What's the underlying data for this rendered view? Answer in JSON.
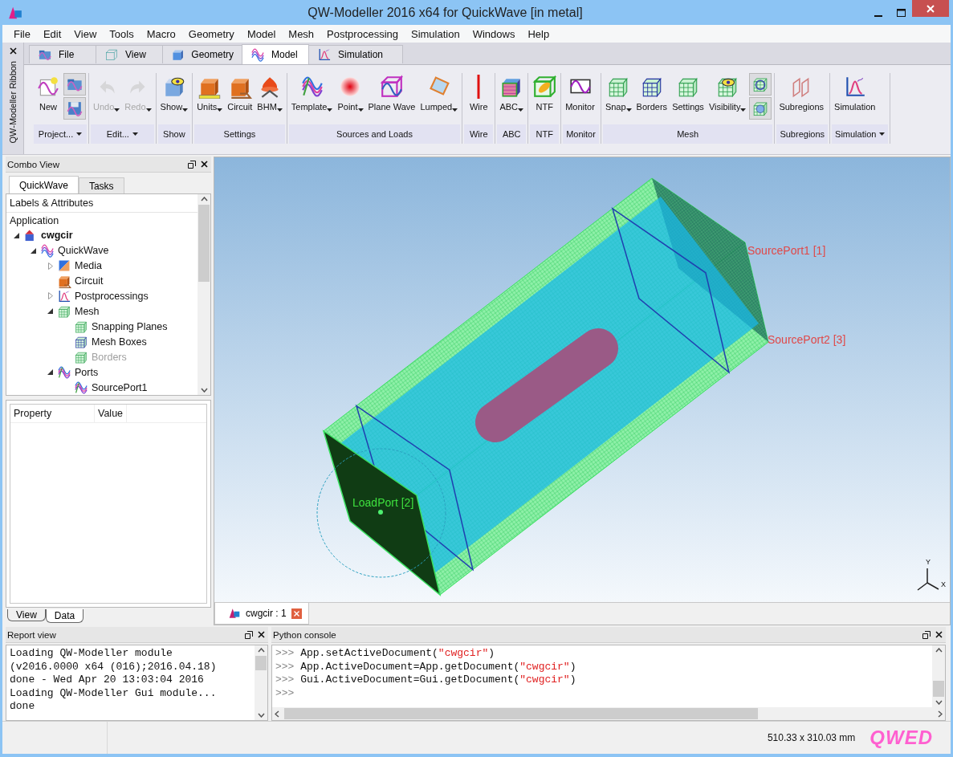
{
  "window": {
    "title": "QW-Modeller 2016 x64 for QuickWave [in metal]"
  },
  "menu": [
    "File",
    "Edit",
    "View",
    "Tools",
    "Macro",
    "Geometry",
    "Model",
    "Mesh",
    "Postprocessing",
    "Simulation",
    "Windows",
    "Help"
  ],
  "ribbon": {
    "side_label": "QW-Modeller Ribbon",
    "tabs": [
      {
        "label": "File",
        "selected": false
      },
      {
        "label": "View",
        "selected": false
      },
      {
        "label": "Geometry",
        "selected": false
      },
      {
        "label": "Model",
        "selected": true
      },
      {
        "label": "Simulation",
        "selected": false
      }
    ],
    "groups": [
      {
        "label": "Project...",
        "menu": true,
        "buttons": [
          {
            "kind": "large",
            "label": "New",
            "dropdown": false,
            "disabled": false
          },
          {
            "kind": "small"
          },
          {
            "kind": "small"
          }
        ]
      },
      {
        "label": "Edit...",
        "menu": true,
        "buttons": [
          {
            "kind": "large",
            "label": "Undo",
            "dropdown": true,
            "disabled": true
          },
          {
            "kind": "large",
            "label": "Redo",
            "dropdown": true,
            "disabled": true
          }
        ]
      },
      {
        "label": "Show",
        "menu": false,
        "buttons": [
          {
            "kind": "large",
            "label": "Show",
            "dropdown": true,
            "disabled": false
          }
        ]
      },
      {
        "label": "Settings",
        "menu": false,
        "buttons": [
          {
            "kind": "large",
            "label": "Units",
            "dropdown": true,
            "disabled": false
          },
          {
            "kind": "large",
            "label": "Circuit",
            "dropdown": false,
            "disabled": false
          },
          {
            "kind": "large",
            "label": "BHM",
            "dropdown": true,
            "disabled": false
          }
        ]
      },
      {
        "label": "Sources and Loads",
        "menu": false,
        "buttons": [
          {
            "kind": "large",
            "label": "Template",
            "dropdown": true,
            "disabled": false
          },
          {
            "kind": "large",
            "label": "Point",
            "dropdown": true,
            "disabled": false
          },
          {
            "kind": "large",
            "label": "Plane Wave",
            "dropdown": false,
            "disabled": false
          },
          {
            "kind": "large",
            "label": "Lumped",
            "dropdown": true,
            "disabled": false
          }
        ]
      },
      {
        "label": "Wire",
        "menu": false,
        "buttons": [
          {
            "kind": "large",
            "label": "Wire",
            "dropdown": false,
            "disabled": false
          }
        ]
      },
      {
        "label": "ABC",
        "menu": false,
        "buttons": [
          {
            "kind": "large",
            "label": "ABC",
            "dropdown": true,
            "disabled": false
          }
        ]
      },
      {
        "label": "NTF",
        "menu": false,
        "buttons": [
          {
            "kind": "large",
            "label": "NTF",
            "dropdown": false,
            "disabled": false
          }
        ]
      },
      {
        "label": "Monitor",
        "menu": false,
        "buttons": [
          {
            "kind": "large",
            "label": "Monitor",
            "dropdown": false,
            "disabled": false
          }
        ]
      },
      {
        "label": "Mesh",
        "menu": false,
        "buttons": [
          {
            "kind": "large",
            "label": "Snap",
            "dropdown": true,
            "disabled": false
          },
          {
            "kind": "large",
            "label": "Borders",
            "dropdown": false,
            "disabled": false
          },
          {
            "kind": "large",
            "label": "Settings",
            "dropdown": false,
            "disabled": false
          },
          {
            "kind": "large",
            "label": "Visibility",
            "dropdown": true,
            "disabled": false
          },
          {
            "kind": "small"
          },
          {
            "kind": "small"
          }
        ]
      },
      {
        "label": "Subregions",
        "menu": false,
        "buttons": [
          {
            "kind": "large",
            "label": "Subregions",
            "dropdown": false,
            "disabled": false
          }
        ]
      },
      {
        "label": "Simulation",
        "menu": true,
        "buttons": [
          {
            "kind": "large",
            "label": "Simulation",
            "dropdown": false,
            "disabled": false
          }
        ]
      }
    ]
  },
  "combo_view": {
    "title": "Combo View",
    "tabs": [
      {
        "label": "QuickWave",
        "selected": true
      },
      {
        "label": "Tasks",
        "selected": false
      }
    ],
    "tree_header": "Labels & Attributes",
    "tree_root": "Application",
    "tree": [
      {
        "label": "cwgcir",
        "expandable": true,
        "expanded": true,
        "bold": true,
        "dimmed": false,
        "children": [
          {
            "label": "QuickWave",
            "expandable": true,
            "expanded": true,
            "bold": false,
            "dimmed": false,
            "children": [
              {
                "label": "Media",
                "expandable": true,
                "expanded": false,
                "bold": false,
                "dimmed": false
              },
              {
                "label": "Circuit",
                "expandable": false,
                "bold": false,
                "dimmed": false
              },
              {
                "label": "Postprocessings",
                "expandable": true,
                "expanded": false,
                "bold": false,
                "dimmed": false
              },
              {
                "label": "Mesh",
                "expandable": true,
                "expanded": true,
                "bold": false,
                "dimmed": false,
                "children": [
                  {
                    "label": "Snapping Planes",
                    "expandable": false,
                    "bold": false,
                    "dimmed": false
                  },
                  {
                    "label": "Mesh Boxes",
                    "expandable": false,
                    "bold": false,
                    "dimmed": false
                  },
                  {
                    "label": "Borders",
                    "expandable": false,
                    "bold": false,
                    "dimmed": true
                  }
                ]
              },
              {
                "label": "Ports",
                "expandable": true,
                "expanded": true,
                "bold": false,
                "dimmed": false,
                "children": [
                  {
                    "label": "SourcePort1",
                    "expandable": false,
                    "bold": false,
                    "dimmed": false
                  }
                ]
              }
            ]
          }
        ]
      }
    ],
    "property_columns": [
      "Property",
      "Value"
    ],
    "bottom_tabs": [
      {
        "label": "View",
        "selected": false
      },
      {
        "label": "Data",
        "selected": true
      }
    ]
  },
  "viewport": {
    "labels": [
      {
        "text": "SourcePort1 [1]",
        "color": "#e04848"
      },
      {
        "text": "SourcePort2 [3]",
        "color": "#e04848"
      },
      {
        "text": "LoadPort [2]",
        "color": "#3ee03e"
      }
    ],
    "axes": [
      "Y",
      "X"
    ],
    "tab": {
      "label": "cwgcir : 1"
    }
  },
  "report_view": {
    "title": "Report view",
    "lines": [
      "Loading QW-Modeller module",
      "(v2016.0000 x64 (016);2016.04.18)",
      "done - Wed Apr 20 13:03:04 2016",
      "Loading QW-Modeller Gui module...",
      "done"
    ]
  },
  "python_console": {
    "title": "Python console",
    "lines": [
      {
        "prompt": ">>>",
        "code": "App.setActiveDocument(",
        "string": "\"cwgcir\"",
        "tail": ")"
      },
      {
        "prompt": ">>>",
        "code": "App.ActiveDocument=App.getDocument(",
        "string": "\"cwgcir\"",
        "tail": ")"
      },
      {
        "prompt": ">>>",
        "code": "Gui.ActiveDocument=Gui.getDocument(",
        "string": "\"cwgcir\"",
        "tail": ")"
      },
      {
        "prompt": ">>>"
      }
    ]
  },
  "status_bar": {
    "dimensions": "510.33 x 310.03 mm",
    "logo": "QWED"
  }
}
